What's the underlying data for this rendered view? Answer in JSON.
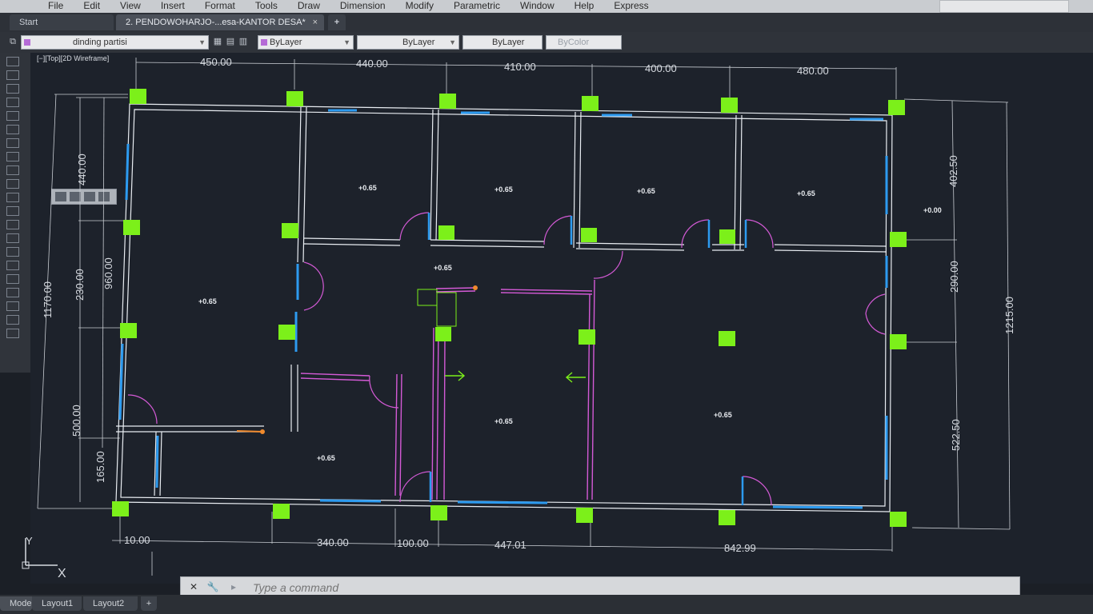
{
  "menu": [
    "File",
    "Edit",
    "View",
    "Insert",
    "Format",
    "Tools",
    "Draw",
    "Dimension",
    "Modify",
    "Parametric",
    "Window",
    "Help",
    "Express"
  ],
  "tabs": {
    "start": "Start",
    "document": "2. PENDOWOHARJO-...esa-KANTOR DESA*",
    "new": "+"
  },
  "properties": {
    "layer": "dinding partisi",
    "color": "ByLayer",
    "linetype": "ByLayer",
    "lineweight": "ByLayer",
    "plotstyle": "ByColor"
  },
  "viewport": {
    "label": "[−][Top][2D Wireframe]"
  },
  "colors": {
    "wall": "#e9edf2",
    "window": "#2d9bf0",
    "partition": "#d45ad6",
    "column": "#7cf01a",
    "dimension": "#c8ccd2",
    "background": "#1d222b"
  },
  "dims": {
    "top": [
      "450.00",
      "440.00",
      "410.00",
      "400.00",
      "480.00"
    ],
    "bottom": [
      "340.00",
      "100.00",
      "447.01",
      "842.99"
    ],
    "left_inner": [
      "440.00",
      "230.00",
      "500.00",
      "165.00"
    ],
    "left_mid": "960.00",
    "left_outer": "1170.00",
    "right_inner": [
      "402.50",
      "290.00",
      "522.50"
    ],
    "right_outer": "1215.00",
    "bottom_left": "10.00"
  },
  "levels": {
    "r1": "+0.65",
    "r2": "+0.65",
    "r3": "+0.65",
    "r4": "+0.65",
    "terrace": "+0.00",
    "corridor": "+0.65",
    "left": "+0.65",
    "bl": "+0.65",
    "center": "+0.65",
    "right": "+0.65"
  },
  "ucs": {
    "y": "Y",
    "x": "X"
  },
  "command": {
    "placeholder": "Type a command",
    "close": "✕",
    "wrench": "🔧"
  },
  "layouts": [
    "Model",
    "Layout1",
    "Layout2",
    "+"
  ]
}
